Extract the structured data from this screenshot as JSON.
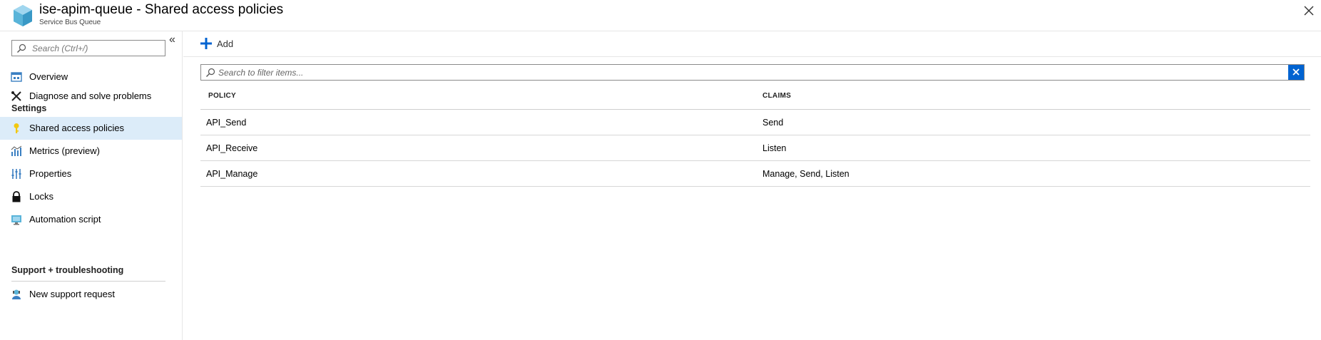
{
  "header": {
    "title": "ise-apim-queue - Shared access policies",
    "subtitle": "Service Bus Queue"
  },
  "sidebar": {
    "search_placeholder": "Search (Ctrl+/)",
    "collapse_glyph": "«",
    "items": [
      {
        "label": "Overview",
        "icon": "overview-icon"
      },
      {
        "label": "Diagnose and solve problems",
        "icon": "wrench-icon"
      }
    ],
    "sections": [
      {
        "title": "Settings",
        "items": [
          {
            "label": "Shared access policies",
            "icon": "key-icon",
            "active": true
          },
          {
            "label": "Metrics (preview)",
            "icon": "metrics-icon"
          },
          {
            "label": "Properties",
            "icon": "properties-icon"
          },
          {
            "label": "Locks",
            "icon": "lock-icon"
          },
          {
            "label": "Automation script",
            "icon": "automation-icon"
          }
        ]
      },
      {
        "title": "Support + troubleshooting",
        "items": [
          {
            "label": "New support request",
            "icon": "support-icon"
          }
        ]
      }
    ]
  },
  "toolbar": {
    "add_label": "Add"
  },
  "filter": {
    "placeholder": "Search to filter items..."
  },
  "table": {
    "columns": [
      "POLICY",
      "CLAIMS"
    ],
    "rows": [
      {
        "policy": "API_Send",
        "claims": "Send"
      },
      {
        "policy": "API_Receive",
        "claims": "Listen"
      },
      {
        "policy": "API_Manage",
        "claims": "Manage, Send, Listen"
      }
    ]
  },
  "colors": {
    "accent": "#0063d1",
    "active_bg": "#dcecf9",
    "key_yellow": "#f2c811"
  }
}
